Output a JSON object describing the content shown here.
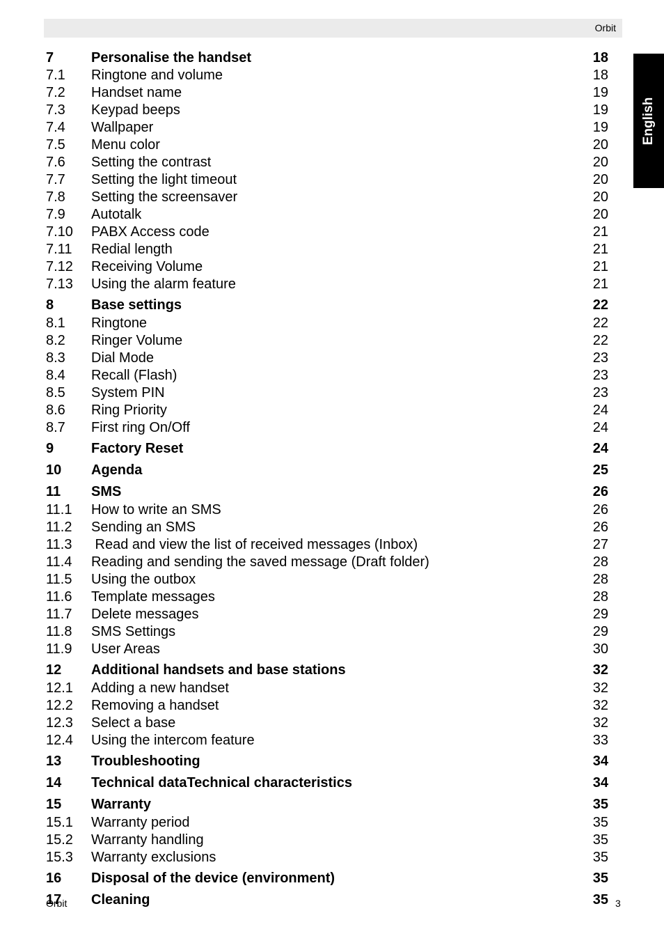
{
  "header": {
    "title": "Orbit"
  },
  "language_tab": {
    "label": "English"
  },
  "toc": [
    {
      "num": "7",
      "title": "Personalise the handset",
      "page": "18",
      "level": 1
    },
    {
      "num": "7.1",
      "title": "Ringtone and volume",
      "page": "18",
      "level": 2
    },
    {
      "num": "7.2",
      "title": "Handset name",
      "page": "19",
      "level": 2
    },
    {
      "num": "7.3",
      "title": "Keypad beeps",
      "page": "19",
      "level": 2
    },
    {
      "num": "7.4",
      "title": "Wallpaper",
      "page": "19",
      "level": 2
    },
    {
      "num": "7.5",
      "title": "Menu color",
      "page": "20",
      "level": 2
    },
    {
      "num": "7.6",
      "title": "Setting the contrast",
      "page": "20",
      "level": 2
    },
    {
      "num": "7.7",
      "title": "Setting the light timeout",
      "page": "20",
      "level": 2
    },
    {
      "num": "7.8",
      "title": "Setting the screensaver",
      "page": "20",
      "level": 2
    },
    {
      "num": "7.9",
      "title": "Autotalk",
      "page": "20",
      "level": 2
    },
    {
      "num": "7.10",
      "title": "PABX Access code",
      "page": "21",
      "level": 2
    },
    {
      "num": "7.11",
      "title": "Redial length",
      "page": "21",
      "level": 2
    },
    {
      "num": "7.12",
      "title": "Receiving Volume",
      "page": "21",
      "level": 2
    },
    {
      "num": "7.13",
      "title": "Using the alarm feature",
      "page": "21",
      "level": 2
    },
    {
      "num": "8",
      "title": "Base settings",
      "page": "22",
      "level": 1
    },
    {
      "num": "8.1",
      "title": "Ringtone",
      "page": "22",
      "level": 2
    },
    {
      "num": "8.2",
      "title": "Ringer Volume",
      "page": "22",
      "level": 2
    },
    {
      "num": "8.3",
      "title": "Dial Mode",
      "page": "23",
      "level": 2
    },
    {
      "num": "8.4",
      "title": "Recall (Flash)",
      "page": "23",
      "level": 2
    },
    {
      "num": "8.5",
      "title": "System PIN",
      "page": "23",
      "level": 2
    },
    {
      "num": "8.6",
      "title": "Ring Priority",
      "page": "24",
      "level": 2
    },
    {
      "num": "8.7",
      "title": "First ring On/Off",
      "page": "24",
      "level": 2
    },
    {
      "num": "9",
      "title": "Factory Reset",
      "page": "24",
      "level": 1
    },
    {
      "num": "10",
      "title": "Agenda",
      "page": "25",
      "level": 1
    },
    {
      "num": "11",
      "title": "SMS",
      "page": "26",
      "level": 1
    },
    {
      "num": "11.1",
      "title": "How to write an SMS",
      "page": "26",
      "level": 2
    },
    {
      "num": "11.2",
      "title": "Sending an SMS",
      "page": "26",
      "level": 2
    },
    {
      "num": "11.3",
      "title": " Read and view the list of received messages (Inbox)",
      "page": "27",
      "level": 2
    },
    {
      "num": "11.4",
      "title": "Reading and sending the saved message (Draft folder)",
      "page": "28",
      "level": 2
    },
    {
      "num": "11.5",
      "title": "Using the outbox",
      "page": "28",
      "level": 2
    },
    {
      "num": "11.6",
      "title": "Template messages",
      "page": "28",
      "level": 2
    },
    {
      "num": "11.7",
      "title": "Delete messages",
      "page": "29",
      "level": 2
    },
    {
      "num": "11.8",
      "title": "SMS Settings",
      "page": "29",
      "level": 2
    },
    {
      "num": "11.9",
      "title": "User Areas",
      "page": "30",
      "level": 2
    },
    {
      "num": "12",
      "title": "Additional handsets and base stations",
      "page": "32",
      "level": 1
    },
    {
      "num": "12.1",
      "title": "Adding a new handset",
      "page": "32",
      "level": 2
    },
    {
      "num": "12.2",
      "title": "Removing a handset",
      "page": "32",
      "level": 2
    },
    {
      "num": "12.3",
      "title": "Select a base",
      "page": "32",
      "level": 2
    },
    {
      "num": "12.4",
      "title": "Using the intercom feature",
      "page": "33",
      "level": 2
    },
    {
      "num": "13",
      "title": "Troubleshooting",
      "page": "34",
      "level": 1
    },
    {
      "num": "14",
      "title": "Technical dataTechnical characteristics",
      "page": "34",
      "level": 1
    },
    {
      "num": "15",
      "title": "Warranty",
      "page": "35",
      "level": 1
    },
    {
      "num": "15.1",
      "title": "Warranty period",
      "page": "35",
      "level": 2
    },
    {
      "num": "15.2",
      "title": "Warranty handling",
      "page": "35",
      "level": 2
    },
    {
      "num": "15.3",
      "title": "Warranty exclusions",
      "page": "35",
      "level": 2
    },
    {
      "num": "16",
      "title": "Disposal of the device (environment)",
      "page": "35",
      "level": 1
    },
    {
      "num": "17",
      "title": "Cleaning",
      "page": "35",
      "level": 1
    }
  ],
  "footer": {
    "left": "Orbit",
    "page_number": "3"
  }
}
